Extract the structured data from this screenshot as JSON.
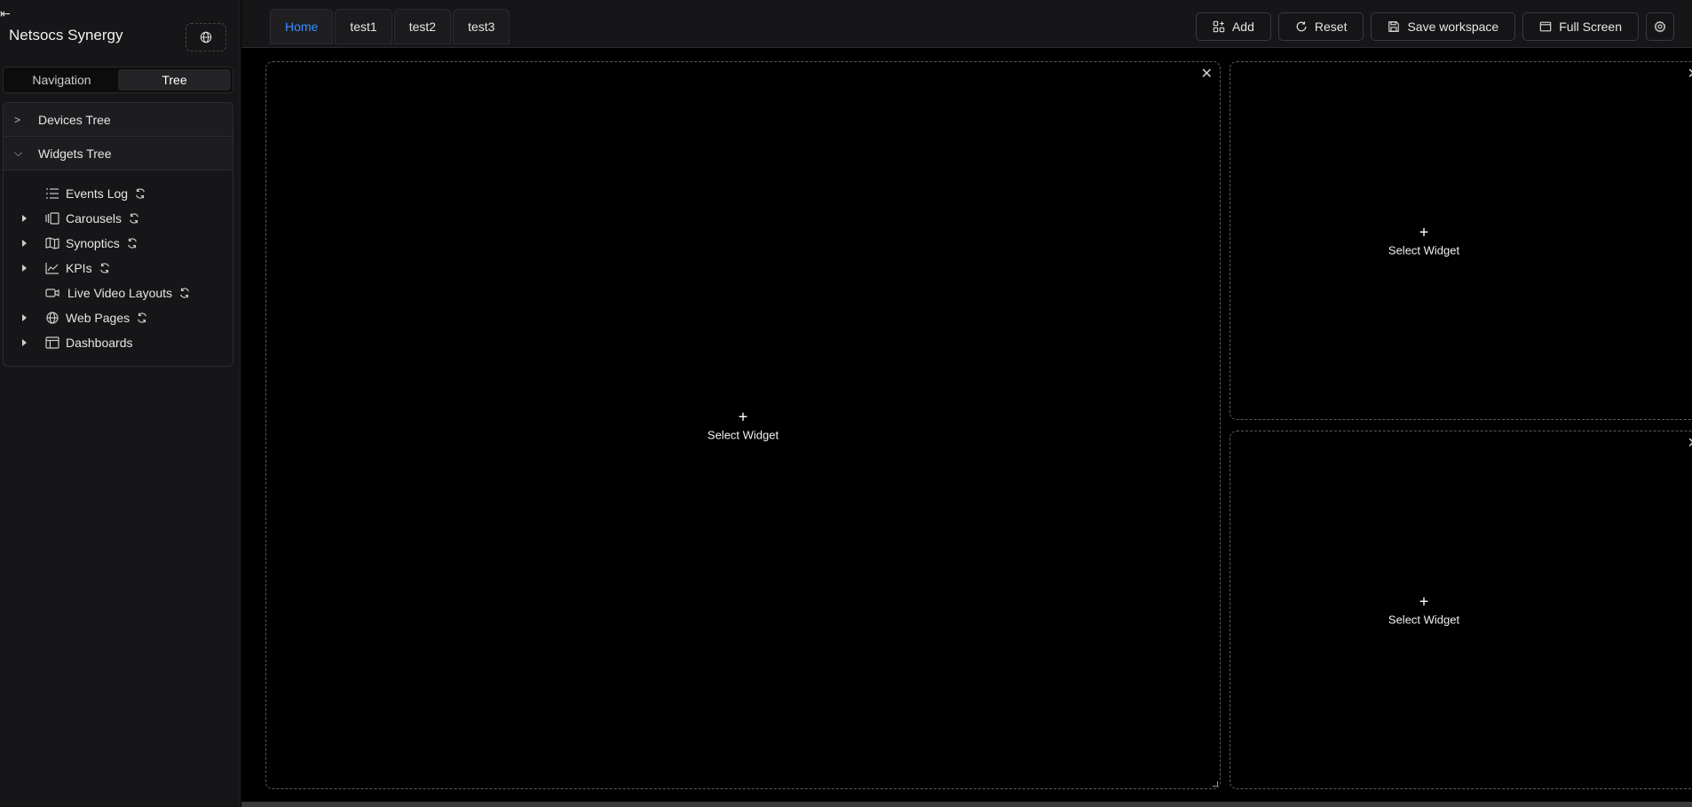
{
  "sidebar": {
    "collapse_icon": "collapse-left-icon",
    "title": "Netsocs Synergy",
    "globe_icon": "globe-icon",
    "segments": [
      {
        "label": "Navigation",
        "active": false
      },
      {
        "label": "Tree",
        "active": true
      }
    ],
    "accordion": {
      "devices": {
        "label": "Devices Tree",
        "expanded": false
      },
      "widgets": {
        "label": "Widgets Tree",
        "expanded": true
      }
    },
    "widgets_items": [
      {
        "label": "Events Log",
        "icon": "list-icon",
        "has_caret": false,
        "has_refresh": true
      },
      {
        "label": "Carousels",
        "icon": "carousel-icon",
        "has_caret": true,
        "has_refresh": true
      },
      {
        "label": "Synoptics",
        "icon": "map-icon",
        "has_caret": true,
        "has_refresh": true
      },
      {
        "label": "KPIs",
        "icon": "chart-line-icon",
        "has_caret": true,
        "has_refresh": true
      },
      {
        "label": "Live Video Layouts",
        "icon": "video-icon",
        "has_caret": false,
        "has_refresh": true
      },
      {
        "label": "Web Pages",
        "icon": "globe-icon",
        "has_caret": true,
        "has_refresh": true
      },
      {
        "label": "Dashboards",
        "icon": "dashboard-icon",
        "has_caret": true,
        "has_refresh": false
      }
    ]
  },
  "tabs": [
    {
      "label": "Home",
      "active": true
    },
    {
      "label": "test1",
      "active": false
    },
    {
      "label": "test2",
      "active": false
    },
    {
      "label": "test3",
      "active": false
    }
  ],
  "toolbar": {
    "add_label": "Add",
    "reset_label": "Reset",
    "save_label": "Save workspace",
    "fullscreen_label": "Full Screen",
    "settings_icon": "gear-icon"
  },
  "workspace": {
    "slots": [
      {
        "plus": "+",
        "label": "Select Widget"
      },
      {
        "plus": "+",
        "label": "Select Widget"
      },
      {
        "plus": "+",
        "label": "Select Widget"
      }
    ],
    "close_glyph": "✕"
  },
  "colors": {
    "accent": "#3b8cff",
    "sidebar_bg": "#161618",
    "workspace_bg": "#000000"
  }
}
